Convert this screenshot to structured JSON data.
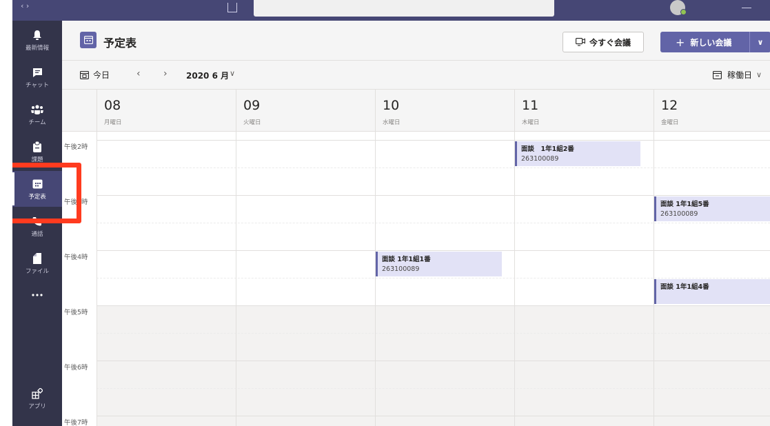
{
  "header": {
    "title": "予定表",
    "meet_now_label": "今すぐ会議",
    "new_meeting_label": "新しい会議"
  },
  "toolbar": {
    "today_label": "今日",
    "month_label": "2020 6 月",
    "view_label": "稼働日"
  },
  "rail": {
    "items": [
      {
        "label": "最新情報",
        "icon": "bell-icon"
      },
      {
        "label": "チャット",
        "icon": "chat-icon"
      },
      {
        "label": "チーム",
        "icon": "teams-icon"
      },
      {
        "label": "課題",
        "icon": "assignments-icon"
      },
      {
        "label": "予定表",
        "icon": "calendar-icon",
        "active": true
      },
      {
        "label": "通話",
        "icon": "phone-icon"
      },
      {
        "label": "ファイル",
        "icon": "file-icon"
      },
      {
        "label": "",
        "icon": "more-icon"
      },
      {
        "label": "アプリ",
        "icon": "apps-icon"
      }
    ]
  },
  "days": [
    {
      "num": "08",
      "name": "月曜日"
    },
    {
      "num": "09",
      "name": "火曜日"
    },
    {
      "num": "10",
      "name": "水曜日"
    },
    {
      "num": "11",
      "name": "木曜日"
    },
    {
      "num": "12",
      "name": "金曜日"
    }
  ],
  "hours": [
    "午後2時",
    "午後3時",
    "午後4時",
    "午後5時",
    "午後6時",
    "午後7時"
  ],
  "events": [
    {
      "day": 3,
      "title": "面談　1年1組2番",
      "subtitle": "263100089"
    },
    {
      "day": 4,
      "title": "面談 1年1組5番",
      "subtitle": "263100089"
    },
    {
      "day": 2,
      "title": "面談 1年1組1番",
      "subtitle": "263100089"
    },
    {
      "day": 4,
      "title": "面談 1年1組4番",
      "subtitle": ""
    }
  ],
  "colors": {
    "accent": "#6264a7",
    "rail_bg": "#33344a",
    "topbar_bg": "#464775",
    "highlight": "#ff3b1f",
    "event_bg": "#e2e2f6"
  }
}
